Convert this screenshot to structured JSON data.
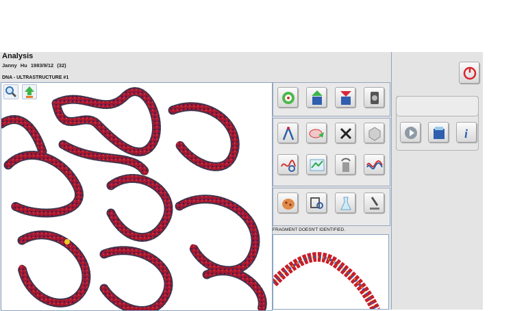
{
  "header": {
    "title": "Analysis",
    "patient_name": "Janny Hu",
    "patient_info": "1983/9/12 (32)"
  },
  "viewer": {
    "subject": "DNA - ULTRASTRUCTURE #1",
    "tools": [
      "zoom-icon",
      "export-icon"
    ]
  },
  "panel": {
    "status": "FRAGMENT DOESN'T IDENTIFIED.",
    "group1": [
      "target-icon",
      "upload-icon",
      "download-icon",
      "gear-icon"
    ],
    "group2": [
      "compass-icon",
      "spectrum-icon",
      "delete-icon",
      "hexagon-icon"
    ],
    "group3": [
      "analysis-icon",
      "chart-icon",
      "recycle-icon",
      "waveform-icon"
    ],
    "group4": [
      "organ-icon",
      "magnify-icon",
      "flask-icon",
      "microscope-icon"
    ]
  },
  "right": {
    "power": "power-icon",
    "icons": [
      "play-icon",
      "database-icon",
      "info-icon"
    ],
    "info_symbol": "i"
  },
  "colors": {
    "accent": "#a8182a",
    "frame": "#8aa3c2",
    "panel": "#e4e4e4",
    "power": "#d9232b"
  }
}
